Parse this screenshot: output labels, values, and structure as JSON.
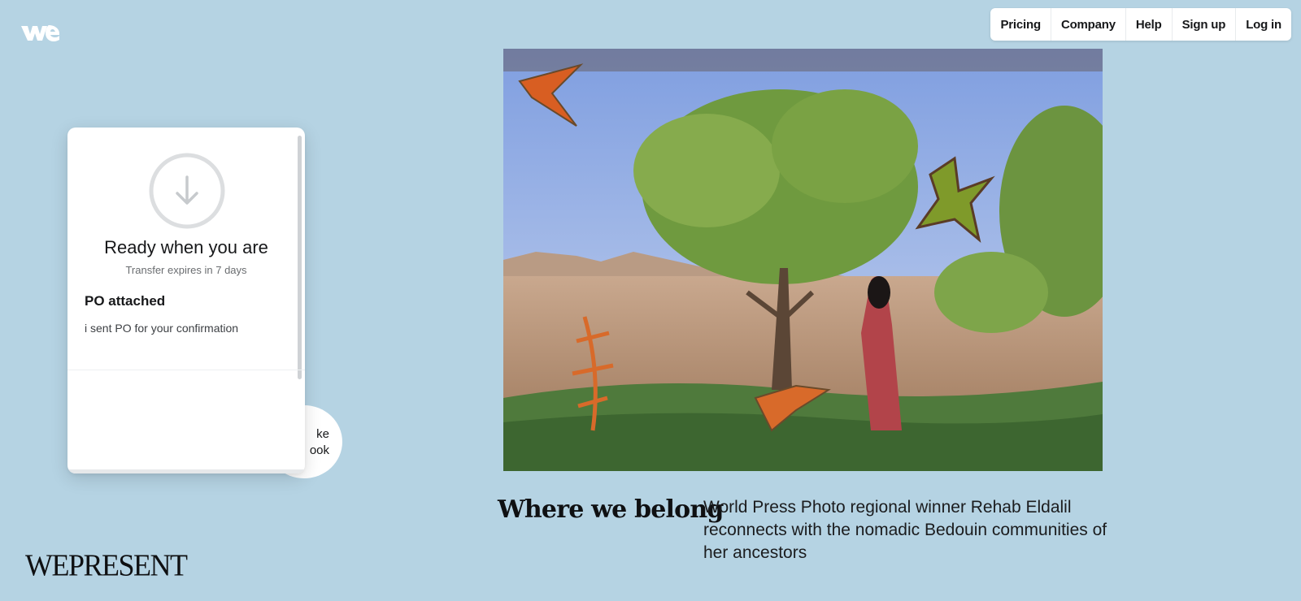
{
  "nav": {
    "items": [
      "Pricing",
      "Company",
      "Help",
      "Sign up",
      "Log in"
    ]
  },
  "transfer_card": {
    "title": "Ready when you are",
    "subtitle": "Transfer expires in 7 days",
    "transfer_name": "PO attached",
    "message": "i sent PO for your confirmation"
  },
  "bubble": {
    "text": "ke\nook"
  },
  "story": {
    "headline": "Where we belong",
    "description": "World Press Photo regional winner Rehab Eldalil reconnects with the nomadic Bedouin communities of her ancestors"
  },
  "brand": {
    "name": "WEPRESENT"
  },
  "colors": {
    "background": "#b5d3e3",
    "card": "#ffffff",
    "text": "#17181a"
  }
}
